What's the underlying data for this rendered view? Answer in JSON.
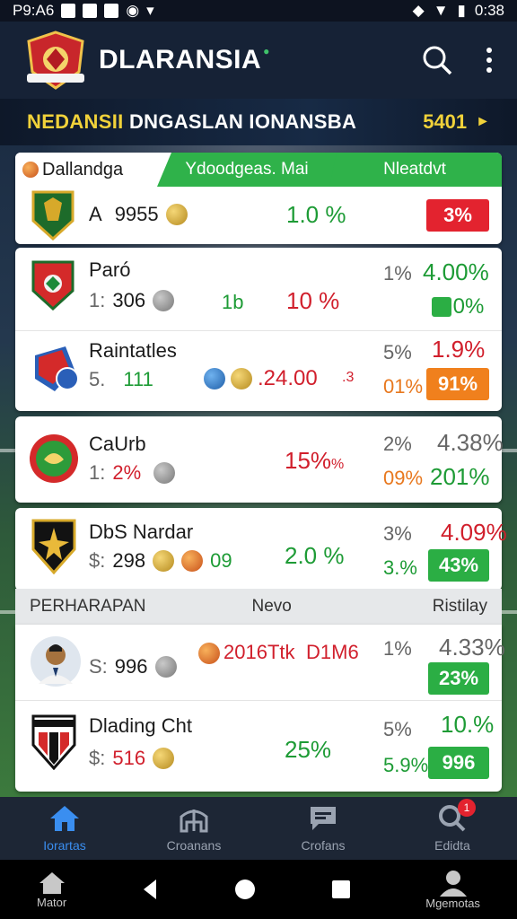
{
  "status": {
    "time": "P9:A6",
    "clock": "0:38"
  },
  "app": {
    "title": "DLARANSIA"
  },
  "league": {
    "title_yellow": "NEDANSII",
    "title_white": " DNGASLAN IONANSBA",
    "count": "5401"
  },
  "card1": {
    "hdr_col1": "Dallandga",
    "hdr_col2": "Ydoodgeas. Mai",
    "hdr_col3": "Nleatdvt",
    "row": {
      "prefix": "A",
      "value": "9955",
      "pct": "1.0 %",
      "badge": "3%"
    }
  },
  "card2": {
    "team1": {
      "name": "Paró",
      "prefix": "1:",
      "value": "306",
      "mid1": "1b",
      "mid2": "10 %",
      "small": "1%",
      "pct": "4.00%",
      "badge": "0%"
    },
    "team2": {
      "name": "Raintatles",
      "prefix": "5.",
      "value": "111",
      "mid": ".24.00",
      "mid_small": ".3",
      "small": "5%",
      "small2": "01%",
      "pct": "1.9%",
      "badge": "91%"
    }
  },
  "card3": {
    "name": "CaUrb",
    "prefix": "1:",
    "value": "2%",
    "mid": "15%",
    "mid_suffix": "%",
    "small": "2%",
    "small2": "09%",
    "pct": "4.38%",
    "pct2": "201%"
  },
  "card4": {
    "name": "DbS Nardar",
    "prefix": "$:",
    "value": "298",
    "num": "09",
    "mid": "2.0 %",
    "small": "3%",
    "small2": "3.%",
    "pct": "4.09%",
    "badge": "43%"
  },
  "section": {
    "left": "PERHARAPAN",
    "mid": "Nevo",
    "right": "Ristilay"
  },
  "card5": {
    "row1": {
      "prefix": "S:",
      "value": "996",
      "mid": "2016Ttk",
      "mid2": "D1M6",
      "small": "1%",
      "pct": "4.33%",
      "badge": "23%"
    },
    "row2": {
      "name": "Dlading Cht",
      "prefix": "$:",
      "value": "516",
      "mid": "25%",
      "small": "5%",
      "small2": "5.9%",
      "pct": "10.%",
      "badge": "996"
    }
  },
  "bottomnav": [
    {
      "label": "Iorartas",
      "icon": "home-icon"
    },
    {
      "label": "Croanans",
      "icon": "stadium-icon"
    },
    {
      "label": "Crofans",
      "icon": "chat-icon"
    },
    {
      "label": "Edidta",
      "icon": "search-icon",
      "badge": "1"
    }
  ],
  "sysnav": {
    "left_label": "Mator",
    "right_label": "Mgemotas"
  },
  "colors": {
    "accent": "#2fb24a",
    "danger": "#e3232f",
    "header": "#162236",
    "highlight": "#f1d23a"
  }
}
